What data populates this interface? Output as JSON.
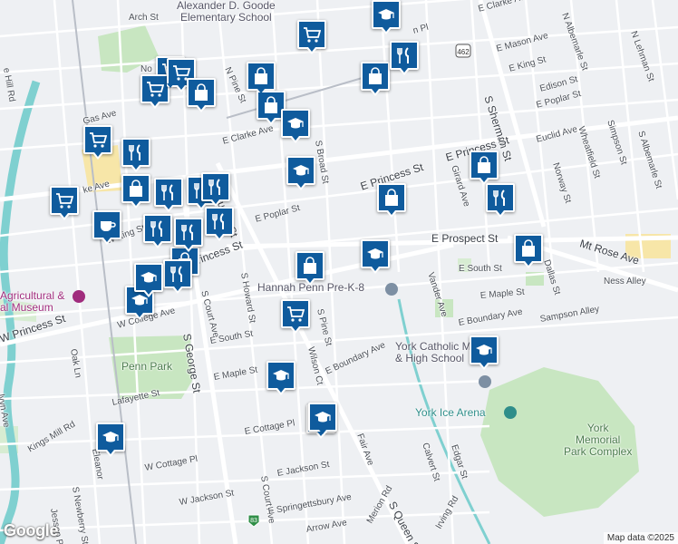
{
  "map": {
    "attribution": "Map data ©2025",
    "logo": "Google",
    "colors": {
      "marker_fill": "#0f5b9d",
      "marker_border": "#ffffff",
      "park_green": "#c8e6c1",
      "water_teal": "#7fd0d0",
      "highlight_yellow": "#f7e6a8",
      "road_white": "#ffffff",
      "background": "#eef0f3",
      "museum_pink": "#a02c7d"
    }
  },
  "places": {
    "school_top": "Alexander D. Goode\nElementary School",
    "hannah_penn": "Hannah Penn Pre-K-8",
    "york_catholic": "York Catholic Middle\n& High School",
    "ice_arena": "York Ice Arena",
    "memorial_park": "York\nMemorial\nPark Complex",
    "penn_park": "Penn Park",
    "museum": "Agricultural &\nal Museum"
  },
  "streets": {
    "arch_st": "Arch St",
    "n_pine_st": "N Pine St",
    "e_clarke_ave_top": "E Clarke Ave",
    "n_albemarle_st": "N Albemarle St",
    "n_lehman_st": "N Lehman St",
    "e_mason_ave": "E Mason Ave",
    "e_king_st_top": "E King St",
    "edison_st": "Edison St",
    "e_poplar_st_right": "E Poplar St",
    "s_sherman_st": "S Sherman St",
    "euclid_ave": "Euclid Ave",
    "wheatfield_st": "Wheatfield St",
    "simpson_st": "Simpson St",
    "s_albemarle_st": "S Albemarle St",
    "norway_st": "Norway St",
    "girard_ave": "Girard Ave",
    "e_princess_st_1": "E Princess St",
    "e_princess_st_2": "E Princess St",
    "s_broad_st": "S Broad St",
    "e_clarke_ave_mid": "E Clarke Ave",
    "e_poplar_st_mid": "E Poplar St",
    "e_prospect_st": "E Prospect St",
    "mt_rose_ave": "Mt Rose Ave",
    "dallas_st": "Dallas St",
    "e_south_st_right": "E South St",
    "vander_ave": "Vander Ave",
    "e_maple_st_right": "E Maple St",
    "ness_alley": "Ness Alley",
    "e_boundary_ave_right": "E Boundary Ave",
    "sampson_alley": "Sampson Alley",
    "s_pine_st": "S Pine St",
    "wilson_ct": "Wilson Ct",
    "e_boundary_ave_mid": "E Boundary Ave",
    "s_queen_st_top": "Queen St",
    "s_queen_st_bottom": "S Queen St",
    "s_howard_st": "S Howard St",
    "s_court_ave_top": "S Court Ave",
    "s_court_ave_bottom": "S Court Ave",
    "e_south_st_mid": "E South St",
    "e_maple_st_mid": "E Maple St",
    "w_princess_st": "W Princess St",
    "princess_st_mid": "Princess St",
    "w_college_ave": "W College Ave",
    "w_king_st": "W King St",
    "s_george_st": "S George St",
    "w_lafayette_st": "Lafayette St",
    "kings_mill_rd": "Kings Mill Rd",
    "w_cottage_pl": "W Cottage Pl",
    "e_cottage_pl": "E Cottage Pl",
    "e_jackson_st": "E Jackson St",
    "w_jackson_st": "W Jackson St",
    "e_springettsbury_ave": "E Springettsbury Ave",
    "arrow_ave": "Arrow Ave",
    "s_newberry_st": "S Newberry St",
    "jessop_pl": "Jessop Pl",
    "fair_ave": "Fair Ave",
    "calvert_st": "Calvert St",
    "edgar_st": "Edgar St",
    "merion_rd": "Merion Rd",
    "irving_rd": "Irving Rd",
    "oak_ln": "Oak Ln",
    "kyn_ave": "lvyn Ave",
    "hill_rd": "e Hill Rd",
    "n_n_st": "N",
    "no_label": "No",
    "gas_ave": "Gas Ave",
    "ke_ave": "ke Ave",
    "clarke_partial": "E Clarke A",
    "eleanor": "Eleanor",
    "w_princess_left": "W Princess St",
    "n_a_pl": "n Pl",
    "dallas_b": "an St",
    "s_albem_b": "S Alber",
    "e_r": "E",
    "r_s": "E P",
    "n_beaver": "rn Ave",
    "f_st": "S F",
    "ky": "N",
    "n_st_left": "N",
    "g_st_left": "G",
    "n_pine_partial": "S",
    "hwy_462": "462",
    "hwy_83": "83"
  },
  "markers": [
    {
      "kind": "grocery",
      "icon": "shopping-cart-icon"
    },
    {
      "kind": "grocery",
      "icon": "shopping-cart-icon"
    },
    {
      "kind": "grocery",
      "icon": "shopping-cart-icon"
    },
    {
      "kind": "grocery",
      "icon": "shopping-cart-icon"
    },
    {
      "kind": "grocery",
      "icon": "shopping-cart-icon"
    },
    {
      "kind": "grocery",
      "icon": "shopping-cart-icon"
    },
    {
      "kind": "grocery",
      "icon": "shopping-cart-icon"
    },
    {
      "kind": "grocery",
      "icon": "shopping-cart-icon"
    },
    {
      "kind": "shopping",
      "icon": "shopping-bag-icon"
    },
    {
      "kind": "shopping",
      "icon": "shopping-bag-icon"
    },
    {
      "kind": "shopping",
      "icon": "shopping-bag-icon"
    },
    {
      "kind": "shopping",
      "icon": "shopping-bag-icon"
    },
    {
      "kind": "shopping",
      "icon": "shopping-bag-icon"
    },
    {
      "kind": "shopping",
      "icon": "shopping-bag-icon"
    },
    {
      "kind": "shopping",
      "icon": "shopping-bag-icon"
    },
    {
      "kind": "shopping",
      "icon": "shopping-bag-icon"
    },
    {
      "kind": "shopping",
      "icon": "shopping-bag-icon"
    },
    {
      "kind": "shopping",
      "icon": "shopping-bag-icon"
    },
    {
      "kind": "restaurant",
      "icon": "fork-knife-icon"
    },
    {
      "kind": "restaurant",
      "icon": "fork-knife-icon"
    },
    {
      "kind": "restaurant",
      "icon": "fork-knife-icon"
    },
    {
      "kind": "restaurant",
      "icon": "fork-knife-icon"
    },
    {
      "kind": "restaurant",
      "icon": "fork-knife-icon"
    },
    {
      "kind": "restaurant",
      "icon": "fork-knife-icon"
    },
    {
      "kind": "restaurant",
      "icon": "fork-knife-icon"
    },
    {
      "kind": "restaurant",
      "icon": "fork-knife-icon"
    },
    {
      "kind": "restaurant",
      "icon": "fork-knife-icon"
    },
    {
      "kind": "restaurant",
      "icon": "fork-knife-icon"
    },
    {
      "kind": "school",
      "icon": "graduation-cap-icon"
    },
    {
      "kind": "school",
      "icon": "graduation-cap-icon"
    },
    {
      "kind": "school",
      "icon": "graduation-cap-icon"
    },
    {
      "kind": "school",
      "icon": "graduation-cap-icon"
    },
    {
      "kind": "school",
      "icon": "graduation-cap-icon"
    },
    {
      "kind": "school",
      "icon": "graduation-cap-icon"
    },
    {
      "kind": "school",
      "icon": "graduation-cap-icon"
    },
    {
      "kind": "school",
      "icon": "graduation-cap-icon"
    },
    {
      "kind": "school",
      "icon": "graduation-cap-icon"
    },
    {
      "kind": "school",
      "icon": "graduation-cap-icon"
    },
    {
      "kind": "cafe",
      "icon": "coffee-cup-icon"
    }
  ]
}
